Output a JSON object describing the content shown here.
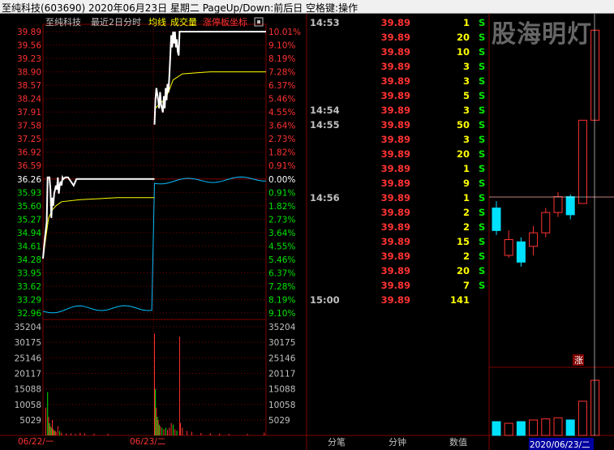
{
  "window": {
    "title": "至纯科技(603690)  2020年06月23日 星期二 PageUp/Down:前后日  空格键:操作"
  },
  "chart_header": {
    "stock_name": "至纯科技",
    "period_label": "最近2日分时",
    "avg_label": "均线",
    "volume_label": "成交量",
    "limit_label": "涨停板坐标"
  },
  "colors": {
    "up": "#ff3232",
    "down": "#00e600",
    "flat": "#ffffff",
    "avg": "#ffff00",
    "grid": "#800000",
    "volume_up": "#ff3232",
    "volume_down": "#00e600",
    "label_yellow": "#ffff00"
  },
  "watermark": "股海明灯",
  "chart_data": {
    "type": "line",
    "title": "",
    "ylim": [
      32.96,
      39.89
    ],
    "prev_close": 36.26,
    "price_ticks": [
      "39.89",
      "39.56",
      "39.23",
      "38.90",
      "38.57",
      "38.24",
      "37.91",
      "37.58",
      "37.25",
      "36.92",
      "36.59",
      "36.26",
      "35.93",
      "35.60",
      "35.27",
      "34.94",
      "34.61",
      "34.28",
      "33.95",
      "33.62",
      "33.29",
      "32.96"
    ],
    "pct_ticks": [
      "10.01%",
      "9.10%",
      "8.19%",
      "7.28%",
      "6.37%",
      "5.46%",
      "4.55%",
      "3.64%",
      "2.73%",
      "1.82%",
      "0.91%",
      "0.00%",
      "0.91%",
      "1.82%",
      "2.73%",
      "3.64%",
      "4.55%",
      "5.46%",
      "6.37%",
      "7.28%",
      "8.19%",
      "9.10%"
    ],
    "volume_ticks": [
      "35204",
      "30175",
      "25146",
      "20117",
      "15088",
      "10058",
      "5029"
    ],
    "x_labels": [
      "06/22/一",
      "06/23/二"
    ],
    "series": [
      {
        "name": "day1",
        "points": [
          [
            0,
            34.3
          ],
          [
            2,
            34.8
          ],
          [
            4,
            35.2
          ],
          [
            5,
            36.3
          ],
          [
            7,
            36.3
          ],
          [
            8,
            36.0
          ],
          [
            9,
            35.3
          ],
          [
            10,
            35.8
          ],
          [
            11,
            35.6
          ],
          [
            12,
            35.9
          ],
          [
            13,
            36.0
          ],
          [
            14,
            36.1
          ],
          [
            15,
            36.0
          ],
          [
            16,
            36.3
          ],
          [
            17,
            35.9
          ],
          [
            18,
            36.1
          ],
          [
            19,
            36.2
          ],
          [
            20,
            36.1
          ],
          [
            21,
            36.3
          ],
          [
            22,
            36.26
          ],
          [
            24,
            36.3
          ],
          [
            27,
            36.3
          ],
          [
            30,
            36.2
          ],
          [
            33,
            36.1
          ],
          [
            36,
            36.26
          ],
          [
            40,
            36.26
          ],
          [
            60,
            36.26
          ],
          [
            90,
            36.26
          ],
          [
            120,
            36.26
          ]
        ]
      },
      {
        "name": "day2",
        "points": [
          [
            120,
            37.6
          ],
          [
            121,
            38.2
          ],
          [
            122,
            38.5
          ],
          [
            124,
            38.2
          ],
          [
            125,
            38.0
          ],
          [
            126,
            38.4
          ],
          [
            127,
            38.1
          ],
          [
            128,
            38.0
          ],
          [
            129,
            37.9
          ],
          [
            130,
            38.3
          ],
          [
            131,
            38.0
          ],
          [
            132,
            38.5
          ],
          [
            133,
            38.2
          ],
          [
            134,
            38.6
          ],
          [
            135,
            38.4
          ],
          [
            136,
            38.8
          ],
          [
            137,
            39.3
          ],
          [
            138,
            39.8
          ],
          [
            139,
            39.5
          ],
          [
            140,
            39.89
          ],
          [
            141,
            39.6
          ],
          [
            142,
            39.89
          ],
          [
            143,
            39.5
          ],
          [
            144,
            39.7
          ],
          [
            145,
            39.4
          ],
          [
            146,
            39.3
          ],
          [
            147,
            39.89
          ],
          [
            150,
            39.89
          ],
          [
            160,
            39.89
          ],
          [
            180,
            39.89
          ],
          [
            210,
            39.89
          ],
          [
            240,
            39.89
          ]
        ]
      }
    ],
    "avg_series": [
      [
        0,
        34.3
      ],
      [
        3,
        34.8
      ],
      [
        6,
        35.3
      ],
      [
        10,
        35.5
      ],
      [
        14,
        35.6
      ],
      [
        20,
        35.7
      ],
      [
        40,
        35.75
      ],
      [
        80,
        35.8
      ],
      [
        120,
        35.8
      ],
      [
        121,
        38.0
      ],
      [
        125,
        38.1
      ],
      [
        130,
        38.2
      ],
      [
        135,
        38.4
      ],
      [
        140,
        38.7
      ],
      [
        150,
        38.85
      ],
      [
        180,
        38.9
      ],
      [
        240,
        38.9
      ]
    ],
    "volumes": [
      {
        "x": 3,
        "v": 9000,
        "dir": "up"
      },
      {
        "x": 5,
        "v": 14000,
        "dir": "down"
      },
      {
        "x": 6,
        "v": 6000,
        "dir": "up"
      },
      {
        "x": 7,
        "v": 4000,
        "dir": "down"
      },
      {
        "x": 8,
        "v": 3000,
        "dir": "up"
      },
      {
        "x": 9,
        "v": 2500,
        "dir": "down"
      },
      {
        "x": 10,
        "v": 5000,
        "dir": "up"
      },
      {
        "x": 11,
        "v": 2000,
        "dir": "up"
      },
      {
        "x": 12,
        "v": 1600,
        "dir": "down"
      },
      {
        "x": 13,
        "v": 1500,
        "dir": "up"
      },
      {
        "x": 14,
        "v": 1200,
        "dir": "up"
      },
      {
        "x": 16,
        "v": 3000,
        "dir": "up"
      },
      {
        "x": 18,
        "v": 1400,
        "dir": "down"
      },
      {
        "x": 20,
        "v": 900,
        "dir": "up"
      },
      {
        "x": 25,
        "v": 600,
        "dir": "up"
      },
      {
        "x": 30,
        "v": 700,
        "dir": "up"
      },
      {
        "x": 35,
        "v": 500,
        "dir": "up"
      },
      {
        "x": 40,
        "v": 900,
        "dir": "up"
      },
      {
        "x": 45,
        "v": 700,
        "dir": "up"
      },
      {
        "x": 55,
        "v": 600,
        "dir": "up"
      },
      {
        "x": 70,
        "v": 500,
        "dir": "up"
      },
      {
        "x": 120,
        "v": 33000,
        "dir": "up"
      },
      {
        "x": 121,
        "v": 15000,
        "dir": "down"
      },
      {
        "x": 122,
        "v": 9000,
        "dir": "up"
      },
      {
        "x": 123,
        "v": 6000,
        "dir": "down"
      },
      {
        "x": 124,
        "v": 5000,
        "dir": "up"
      },
      {
        "x": 125,
        "v": 3500,
        "dir": "down"
      },
      {
        "x": 126,
        "v": 3000,
        "dir": "up"
      },
      {
        "x": 128,
        "v": 2500,
        "dir": "down"
      },
      {
        "x": 130,
        "v": 2000,
        "dir": "up"
      },
      {
        "x": 132,
        "v": 2500,
        "dir": "down"
      },
      {
        "x": 134,
        "v": 1800,
        "dir": "up"
      },
      {
        "x": 136,
        "v": 2500,
        "dir": "up"
      },
      {
        "x": 138,
        "v": 4000,
        "dir": "up"
      },
      {
        "x": 140,
        "v": 3500,
        "dir": "down"
      },
      {
        "x": 142,
        "v": 2000,
        "dir": "up"
      },
      {
        "x": 144,
        "v": 1500,
        "dir": "down"
      },
      {
        "x": 147,
        "v": 32000,
        "dir": "up"
      },
      {
        "x": 148,
        "v": 4000,
        "dir": "up"
      },
      {
        "x": 150,
        "v": 2500,
        "dir": "up"
      },
      {
        "x": 155,
        "v": 1500,
        "dir": "up"
      },
      {
        "x": 160,
        "v": 1200,
        "dir": "up"
      },
      {
        "x": 170,
        "v": 800,
        "dir": "up"
      },
      {
        "x": 180,
        "v": 700,
        "dir": "up"
      },
      {
        "x": 190,
        "v": 600,
        "dir": "up"
      },
      {
        "x": 200,
        "v": 500,
        "dir": "up"
      },
      {
        "x": 220,
        "v": 500,
        "dir": "up"
      },
      {
        "x": 238,
        "v": 900,
        "dir": "up"
      }
    ],
    "vol_max": 35204
  },
  "trades": [
    {
      "time": "14:53",
      "price": "39.89",
      "vol": "1",
      "flag": "S"
    },
    {
      "time": "",
      "price": "39.89",
      "vol": "20",
      "flag": "S"
    },
    {
      "time": "",
      "price": "39.89",
      "vol": "10",
      "flag": "S"
    },
    {
      "time": "",
      "price": "39.89",
      "vol": "3",
      "flag": "S"
    },
    {
      "time": "",
      "price": "39.89",
      "vol": "3",
      "flag": "S"
    },
    {
      "time": "",
      "price": "39.89",
      "vol": "5",
      "flag": "S"
    },
    {
      "time": "14:54",
      "price": "39.89",
      "vol": "3",
      "flag": "S"
    },
    {
      "time": "14:55",
      "price": "39.89",
      "vol": "50",
      "flag": "S"
    },
    {
      "time": "",
      "price": "39.89",
      "vol": "3",
      "flag": "S"
    },
    {
      "time": "",
      "price": "39.89",
      "vol": "20",
      "flag": "S"
    },
    {
      "time": "",
      "price": "39.89",
      "vol": "1",
      "flag": "S"
    },
    {
      "time": "",
      "price": "39.89",
      "vol": "9",
      "flag": "S"
    },
    {
      "time": "14:56",
      "price": "39.89",
      "vol": "1",
      "flag": "S"
    },
    {
      "time": "",
      "price": "39.89",
      "vol": "2",
      "flag": "S"
    },
    {
      "time": "",
      "price": "39.89",
      "vol": "2",
      "flag": "S"
    },
    {
      "time": "",
      "price": "39.89",
      "vol": "15",
      "flag": "S"
    },
    {
      "time": "",
      "price": "39.89",
      "vol": "2",
      "flag": "S"
    },
    {
      "time": "",
      "price": "39.89",
      "vol": "20",
      "flag": "S"
    },
    {
      "time": "",
      "price": "39.89",
      "vol": "7",
      "flag": "S"
    },
    {
      "time": "15:00",
      "price": "39.89",
      "vol": "141",
      "flag": ""
    }
  ],
  "tabs": [
    "分笔",
    "分钟",
    "数值"
  ],
  "mini_chart": {
    "date_label": "2020/06/23/二",
    "limit_badge": "涨",
    "candles": [
      {
        "o": 36.0,
        "c": 35.0,
        "h": 36.3,
        "l": 34.8,
        "up": false
      },
      {
        "o": 33.9,
        "c": 34.6,
        "h": 35.0,
        "l": 33.8,
        "up": true
      },
      {
        "o": 34.5,
        "c": 33.6,
        "h": 34.7,
        "l": 33.4,
        "up": false
      },
      {
        "o": 34.3,
        "c": 34.9,
        "h": 35.2,
        "l": 33.9,
        "up": true
      },
      {
        "o": 34.9,
        "c": 35.8,
        "h": 36.0,
        "l": 34.7,
        "up": true
      },
      {
        "o": 35.8,
        "c": 36.5,
        "h": 36.7,
        "l": 35.6,
        "up": true
      },
      {
        "o": 36.5,
        "c": 35.7,
        "h": 36.6,
        "l": 35.5,
        "up": false
      },
      {
        "o": 36.2,
        "c": 39.89,
        "h": 39.89,
        "l": 36.2,
        "up": true
      },
      {
        "o": 39.89,
        "c": 43.88,
        "h": 43.88,
        "l": 39.89,
        "up": true
      }
    ],
    "volumes": [
      0.25,
      0.22,
      0.25,
      0.28,
      0.3,
      0.32,
      0.28,
      0.62,
      1.0
    ]
  }
}
